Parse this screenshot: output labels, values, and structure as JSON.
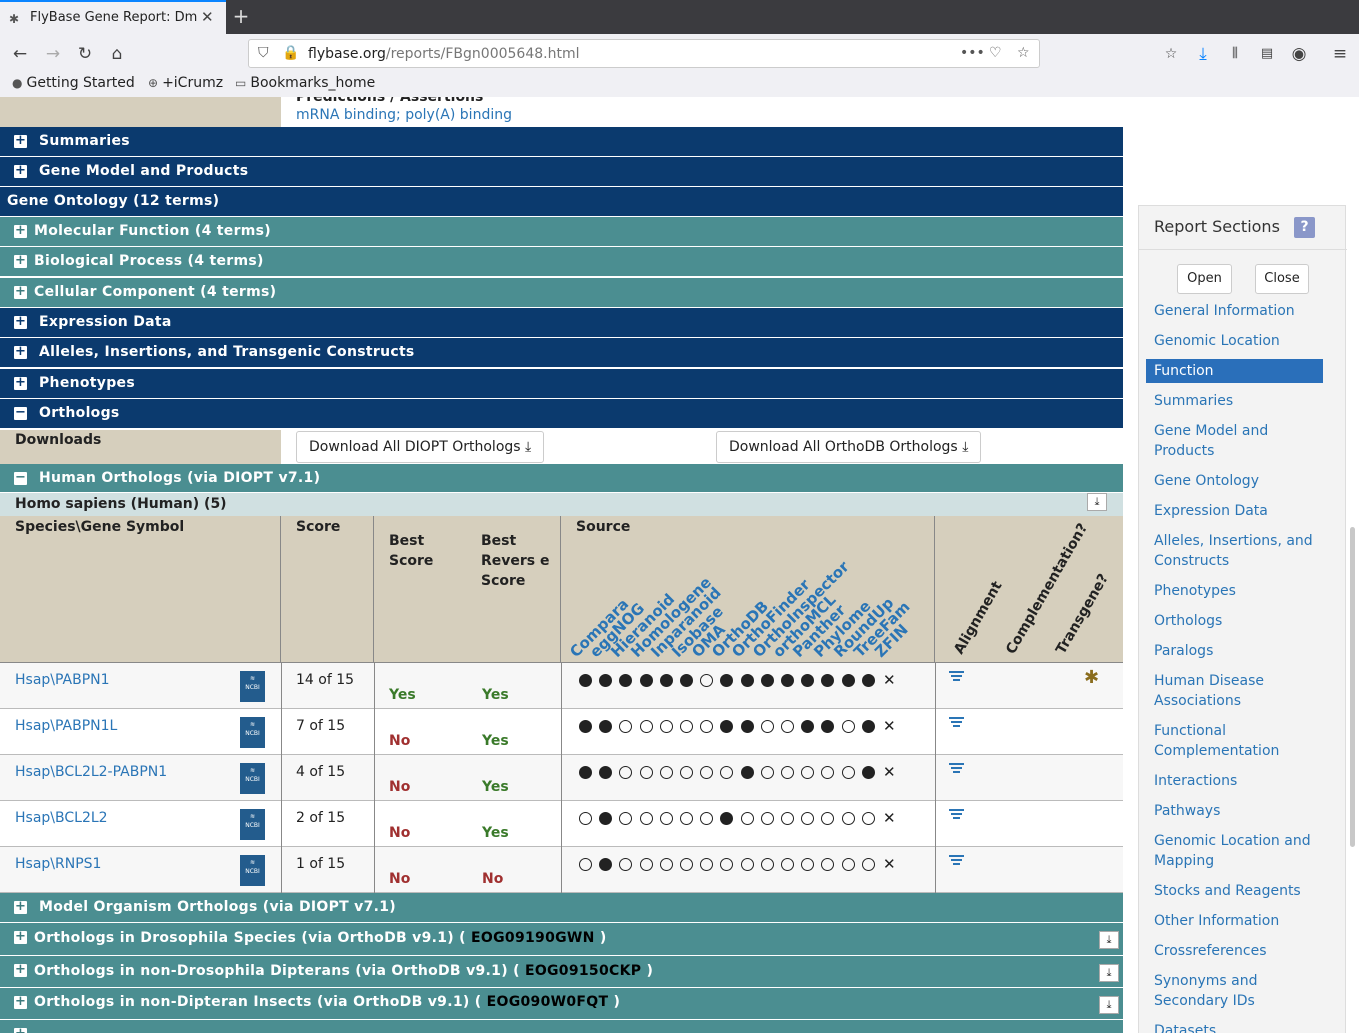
{
  "browser": {
    "tab_title": "FlyBase Gene Report: Dm",
    "url_host": "flybase.org",
    "url_path": "/reports/FBgn0005648.html",
    "bookmarks": [
      "Getting Started",
      "+iCrumz",
      "Bookmarks_home"
    ]
  },
  "top": {
    "cut_heading": "Predictions / Assertions",
    "links": "mRNA binding; poly(A) binding"
  },
  "bands": {
    "summaries": "Summaries",
    "gene_model": "Gene Model and Products",
    "go_header": "Gene Ontology (12 terms)",
    "mol_func": "Molecular Function (4 terms)",
    "bio_proc": "Biological Process (4 terms)",
    "cell_comp": "Cellular Component (4 terms)",
    "expression": "Expression Data",
    "alleles": "Alleles, Insertions, and Transgenic Constructs",
    "phenotypes": "Phenotypes",
    "orthologs": "Orthologs",
    "human_orth": "Human Orthologs (via DIOPT v7.1)",
    "model_orth": "Model Organism Orthologs (via DIOPT v7.1)",
    "dros_species": "Orthologs in Drosophila Species (via OrthoDB v9.1) ( ",
    "dros_species_id": "EOG09190GWN",
    "non_dros": "Orthologs in non-Drosophila Dipterans (via OrthoDB v9.1) ( ",
    "non_dros_id": "EOG09150CKP",
    "non_dipt": "Orthologs in non-Dipteran Insects (via OrthoDB v9.1) ( ",
    "non_dipt_id": "EOG090W0FQT",
    "close_paren": " )"
  },
  "downloads": {
    "label": "Downloads",
    "diopt": "Download All DIOPT Orthologs",
    "orthodb": "Download All OrthoDB Orthologs"
  },
  "species_header": "Homo sapiens (Human) (5)",
  "table": {
    "col_species": "Species\\Gene Symbol",
    "col_score": "Score",
    "col_best": "Best Score",
    "col_best_rev": "Best Revers e Score",
    "col_source": "Source",
    "sources": [
      "Compara",
      "eggNOG",
      "Hieranoid",
      "Homologene",
      "Inparanoid",
      "Isobase",
      "OMA",
      "OrthoDB",
      "OrthoFinder",
      "OrthoInspector",
      "orthoMCL",
      "Panther",
      "Phylome",
      "RoundUp",
      "TreeFam",
      "ZFIN"
    ],
    "extra_cols": [
      "Alignment",
      "Complementation?",
      "Transgene?"
    ],
    "rows": [
      {
        "gene": "Hsap\\PABPN1",
        "score": "14 of 15",
        "best": "Yes",
        "best_rev": "Yes",
        "dots": [
          1,
          1,
          1,
          1,
          1,
          1,
          0,
          1,
          1,
          1,
          1,
          1,
          1,
          1,
          1
        ]
      },
      {
        "gene": "Hsap\\PABPN1L",
        "score": "7 of 15",
        "best": "No",
        "best_rev": "Yes",
        "dots": [
          1,
          1,
          0,
          0,
          0,
          0,
          0,
          1,
          1,
          0,
          0,
          1,
          1,
          0,
          1
        ]
      },
      {
        "gene": "Hsap\\BCL2L2-PABPN1",
        "score": "4 of 15",
        "best": "No",
        "best_rev": "Yes",
        "dots": [
          1,
          1,
          0,
          0,
          0,
          0,
          0,
          0,
          1,
          0,
          0,
          0,
          0,
          0,
          1
        ]
      },
      {
        "gene": "Hsap\\BCL2L2",
        "score": "2 of 15",
        "best": "No",
        "best_rev": "Yes",
        "dots": [
          0,
          1,
          0,
          0,
          0,
          0,
          0,
          1,
          0,
          0,
          0,
          0,
          0,
          0,
          0
        ]
      },
      {
        "gene": "Hsap\\RNPS1",
        "score": "1 of 15",
        "best": "No",
        "best_rev": "No",
        "dots": [
          0,
          1,
          0,
          0,
          0,
          0,
          0,
          0,
          0,
          0,
          0,
          0,
          0,
          0,
          0
        ]
      }
    ]
  },
  "sidebar": {
    "title": "Report Sections",
    "help": "?",
    "open": "Open",
    "close": "Close",
    "items": [
      "General Information",
      "Genomic Location",
      "Function",
      "Summaries",
      "Gene Model and Products",
      "Gene Ontology",
      "Expression Data",
      "Alleles, Insertions, and Constructs",
      "Phenotypes",
      "Orthologs",
      "Paralogs",
      "Human Disease Associations",
      "Functional Complementation",
      "Interactions",
      "Pathways",
      "Genomic Location and Mapping",
      "Stocks and Reagents",
      "Other Information",
      "Crossreferences",
      "Synonyms and Secondary IDs",
      "Datasets"
    ],
    "active": "Function"
  },
  "colors": {
    "dark_band": "#0b3a6e",
    "teal_band": "#4b8e91",
    "yes": "#3a7a2a",
    "no": "#a03030",
    "link": "#2a75b6"
  }
}
